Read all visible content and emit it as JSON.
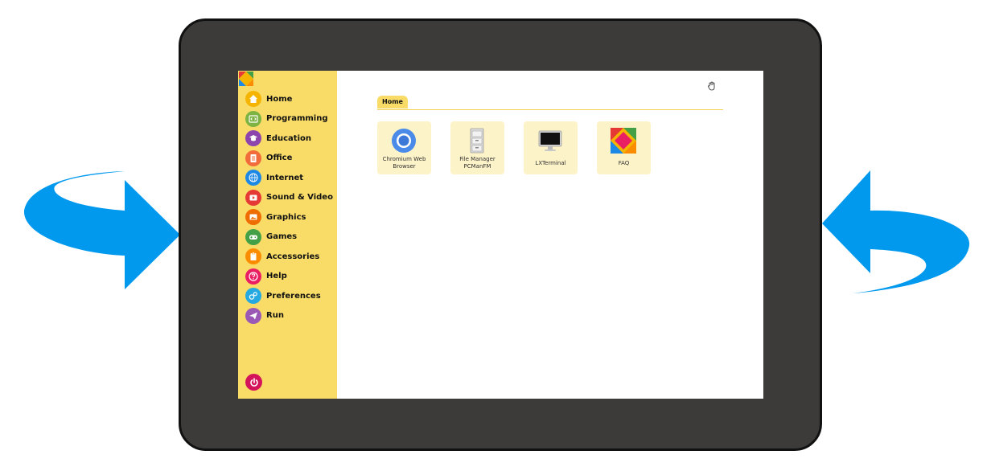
{
  "sidebar": {
    "items": [
      {
        "label": "Home",
        "icon": "home-icon",
        "color": "#f5b400"
      },
      {
        "label": "Programming",
        "icon": "code-icon",
        "color": "#7cb342"
      },
      {
        "label": "Education",
        "icon": "graduation-cap-icon",
        "color": "#8e44ad"
      },
      {
        "label": "Office",
        "icon": "document-icon",
        "color": "#f26b3a"
      },
      {
        "label": "Internet",
        "icon": "globe-icon",
        "color": "#1e88e5"
      },
      {
        "label": "Sound & Video",
        "icon": "play-icon",
        "color": "#e53935"
      },
      {
        "label": "Graphics",
        "icon": "image-icon",
        "color": "#ef6c00"
      },
      {
        "label": "Games",
        "icon": "gamepad-icon",
        "color": "#43a047"
      },
      {
        "label": "Accessories",
        "icon": "clipboard-icon",
        "color": "#fb8c00"
      },
      {
        "label": "Help",
        "icon": "question-icon",
        "color": "#e91e63"
      },
      {
        "label": "Preferences",
        "icon": "gears-icon",
        "color": "#26a9e0"
      },
      {
        "label": "Run",
        "icon": "send-icon",
        "color": "#9b59b6"
      }
    ],
    "power_icon": "power-icon",
    "power_color": "#d4145a"
  },
  "main": {
    "breadcrumb": "Home",
    "apps": [
      {
        "label": "Chromium Web Browser",
        "icon": "chromium-icon"
      },
      {
        "label": "File Manager PCManFM",
        "icon": "file-cabinet-icon"
      },
      {
        "label": "LXTerminal",
        "icon": "monitor-icon"
      },
      {
        "label": "FAQ",
        "icon": "faq-icon"
      }
    ]
  },
  "colors": {
    "device_frame": "#3c3b3a",
    "sidebar_bg": "#f8dc67",
    "tile_bg": "#fdf3c8",
    "arrow_blue": "#0099ee"
  }
}
